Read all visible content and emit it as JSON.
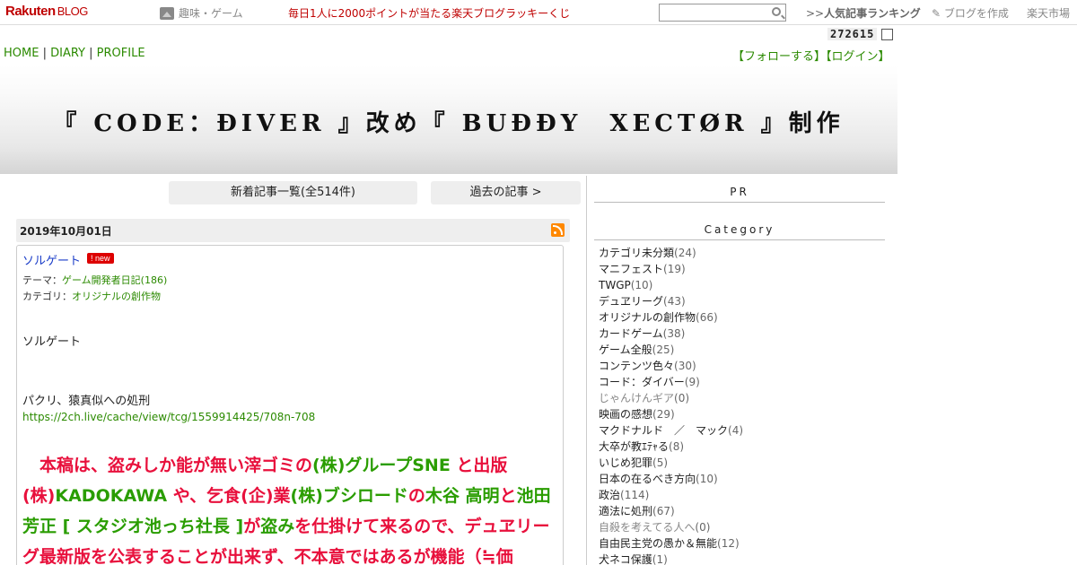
{
  "topbar": {
    "logo": "Rakuten",
    "logo_blog": "BLOG",
    "genre": "趣味・ゲーム",
    "lottery": "毎日1人に2000ポイントが当たる楽天ブログラッキーくじ",
    "search_value": "",
    "ranking_prefix": ">>",
    "ranking": "人気記事ランキング",
    "make_blog": "ブログを作成",
    "market": "楽天市場"
  },
  "counter": "272615",
  "nav": {
    "home": "HOME",
    "sep1": " | ",
    "diary": "DIARY",
    "sep2": " | ",
    "profile": "PROFILE"
  },
  "follow": "【フォローする】【ログイン】",
  "blog_title": "『 CODE：ĐIVER 』改め『 BUĐĐY　XECTØR 』制作",
  "buttons": {
    "list": "新着記事一覧(全514件)",
    "past": "過去の記事 >"
  },
  "entry": {
    "date": "2019年10月01日",
    "title": "ソルゲート",
    "badge": "new",
    "theme_label": "テーマ：",
    "theme": "ゲーム開発者日記(186)",
    "category_label": "カテゴリ：",
    "category": "オリジナルの創作物",
    "p1": "ソルゲート",
    "p2": "パクリ、猿真似への処刑",
    "url": "https://2ch.live/cache/view/tcg/1559914425/708n-708",
    "big": [
      {
        "t": "　本稿は、盗みしか能が無い滓ゴミの",
        "c": "r"
      },
      {
        "t": "(株)グループSNE",
        "c": "g"
      },
      {
        "t": " と出版(株)",
        "c": "r"
      },
      {
        "t": "KADOKAWA",
        "c": "g"
      },
      {
        "t": " や、乞食(企)業",
        "c": "r"
      },
      {
        "t": "(株)ブシロード",
        "c": "g"
      },
      {
        "t": "の",
        "c": "r"
      },
      {
        "t": "木谷 高明",
        "c": "g"
      },
      {
        "t": "と",
        "c": "r"
      },
      {
        "t": "池田 芳正 [ スタジオ池っち社長 ]",
        "c": "g"
      },
      {
        "t": "が",
        "c": "r"
      },
      {
        "t": "盗み",
        "c": "g"
      },
      {
        "t": "を仕掛けて来るので、デュヱリーグ最新版を公表することが出来ず、不本意ではあるが機能（≒価",
        "c": "r"
      }
    ]
  },
  "sidebar": {
    "pr": "PR",
    "category_head": "Category",
    "categories": [
      {
        "name": "カテゴリ未分類",
        "count": "(24)"
      },
      {
        "name": "マニフェスト",
        "count": "(19)"
      },
      {
        "name": "TWGP",
        "count": "(10)"
      },
      {
        "name": "デュヱリーグ",
        "count": "(43)"
      },
      {
        "name": "オリジナルの創作物",
        "count": "(66)"
      },
      {
        "name": "カードゲーム",
        "count": "(38)"
      },
      {
        "name": "ゲーム全般",
        "count": "(25)"
      },
      {
        "name": "コンテンツ色々",
        "count": "(30)"
      },
      {
        "name": "コード：ダイバー",
        "count": "(9)"
      },
      {
        "name": "じゃんけんギア",
        "count": "(0)"
      },
      {
        "name": "映画の感想",
        "count": "(29)"
      },
      {
        "name": "マクドナルド　／　マック",
        "count": "(4)"
      },
      {
        "name": "大卒が教ｴﾃｬる",
        "count": "(8)"
      },
      {
        "name": "いじめ犯罪",
        "count": "(5)"
      },
      {
        "name": "日本の在るべき方向",
        "count": "(10)"
      },
      {
        "name": "政治",
        "count": "(114)"
      },
      {
        "name": "適法に処刑",
        "count": "(67)"
      },
      {
        "name": "自殺を考えてる人へ",
        "count": "(0)"
      },
      {
        "name": "自由民主党の愚か＆無能",
        "count": "(12)"
      },
      {
        "name": "犬ネコ保護",
        "count": "(1)"
      }
    ]
  }
}
